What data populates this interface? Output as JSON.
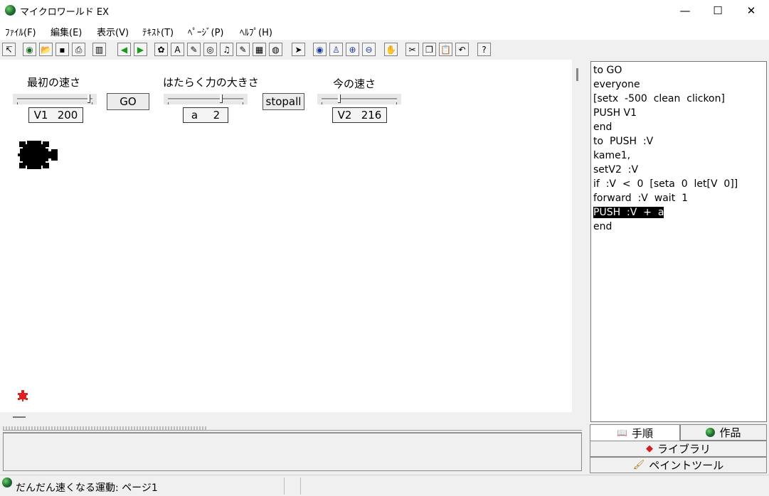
{
  "window": {
    "title": "マイクロワールド EX",
    "controls": {
      "minimize": "—",
      "maximize": "☐",
      "close": "✕"
    }
  },
  "menu": [
    "ﾌｧｲﾙ(F)",
    "編集(E)",
    "表示(V)",
    "ﾃｷｽﾄ(T)",
    "ﾍﾟｰｼﾞ(P)",
    "ﾍﾙﾌﾟ(H)"
  ],
  "toolbar": {
    "icons": [
      "cursor-arrow-icon",
      "globe-icon",
      "open-folder-icon",
      "save-icon",
      "print-icon",
      "layout-icon",
      "arrow-left-icon",
      "arrow-right-icon",
      "turtle-new-icon",
      "text-box-icon",
      "paint-icon",
      "eye-shape-icon",
      "music-icon",
      "melody-icon",
      "video-icon",
      "sound-icon",
      "pointer-icon",
      "eye-icon",
      "stamp-icon",
      "zoom-in-icon",
      "zoom-out-icon",
      "stop-hand-icon",
      "cut-icon",
      "copy-icon",
      "paste-icon",
      "undo-icon",
      "help-icon"
    ],
    "glyphs": [
      "↸",
      "◉",
      "📂",
      "▪",
      "⎙",
      "▥",
      "◀",
      "▶",
      "✿",
      "A",
      "✎",
      "◎",
      "♫",
      "✎",
      "▦",
      "◍",
      "➤",
      "◉",
      "♙",
      "⊕",
      "⊖",
      "✋",
      "✂",
      "❐",
      "📋",
      "↶",
      "?"
    ]
  },
  "canvas": {
    "slider1": {
      "label": "最初の速さ",
      "var": "V1",
      "value": "200",
      "level_pct": 95
    },
    "go_button": "GO",
    "slider2": {
      "label": "はたらく力の大きさ",
      "var": "a",
      "value": "2",
      "level_pct": 70
    },
    "stopall_button": "stopall",
    "slider3": {
      "label": "今の速さ",
      "var": "V2",
      "value": "216",
      "level_pct": 22
    }
  },
  "code": {
    "lines": [
      "to GO",
      "everyone",
      "[setx  -500  clean  clickon]",
      "PUSH V1",
      "end",
      "to  PUSH  :V",
      "kame1,",
      "setV2  :V",
      "if  :V  <  0  [seta  0  let[V  0]]",
      "forward  :V  wait  1",
      "PUSH  :V  +  a",
      "end"
    ],
    "selected_line": "PUSH  :V  +  a"
  },
  "tabs": {
    "procedures": "手順",
    "works": "作品",
    "library": "ライブラリ",
    "paint_tools": "ペイントツール"
  },
  "status": {
    "page_label": "だんだん速くなる運動: ページ1"
  },
  "colors": {
    "small_turtle": "#e02020",
    "turtle": "#000000"
  }
}
